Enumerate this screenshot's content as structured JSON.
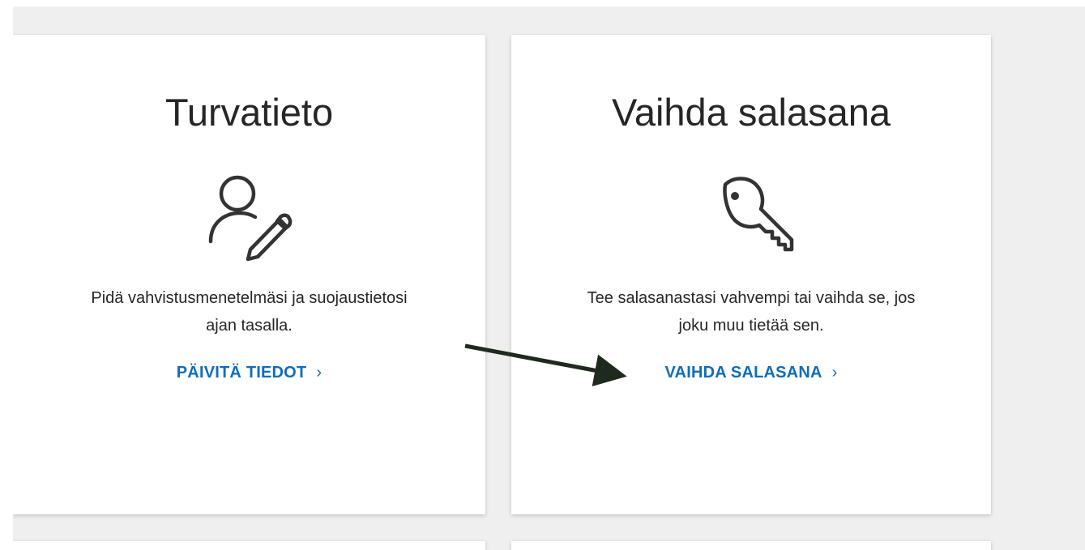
{
  "cards": [
    {
      "title": "Turvatieto",
      "icon": "user-edit-icon",
      "description_line1": "Pidä vahvistusmenetelmäsi ja suojaustietosi",
      "description_line2": "ajan tasalla.",
      "link_label": "PÄIVITÄ TIEDOT",
      "link_chevron": "›"
    },
    {
      "title": "Vaihda salasana",
      "icon": "key-icon",
      "description_line1": "Tee salasanastasi vahvempi tai vaihda se, jos",
      "description_line2": "joku muu tietää sen.",
      "link_label": "VAIHDA SALASANA",
      "link_chevron": "›"
    }
  ],
  "colors": {
    "background": "#efefef",
    "card": "#ffffff",
    "text": "#262626",
    "link": "#0f6cbd",
    "annotation_arrow": "#1f2a1f"
  },
  "annotation": {
    "icon": "arrow-icon",
    "points_to": "VAIHDA SALASANA"
  }
}
